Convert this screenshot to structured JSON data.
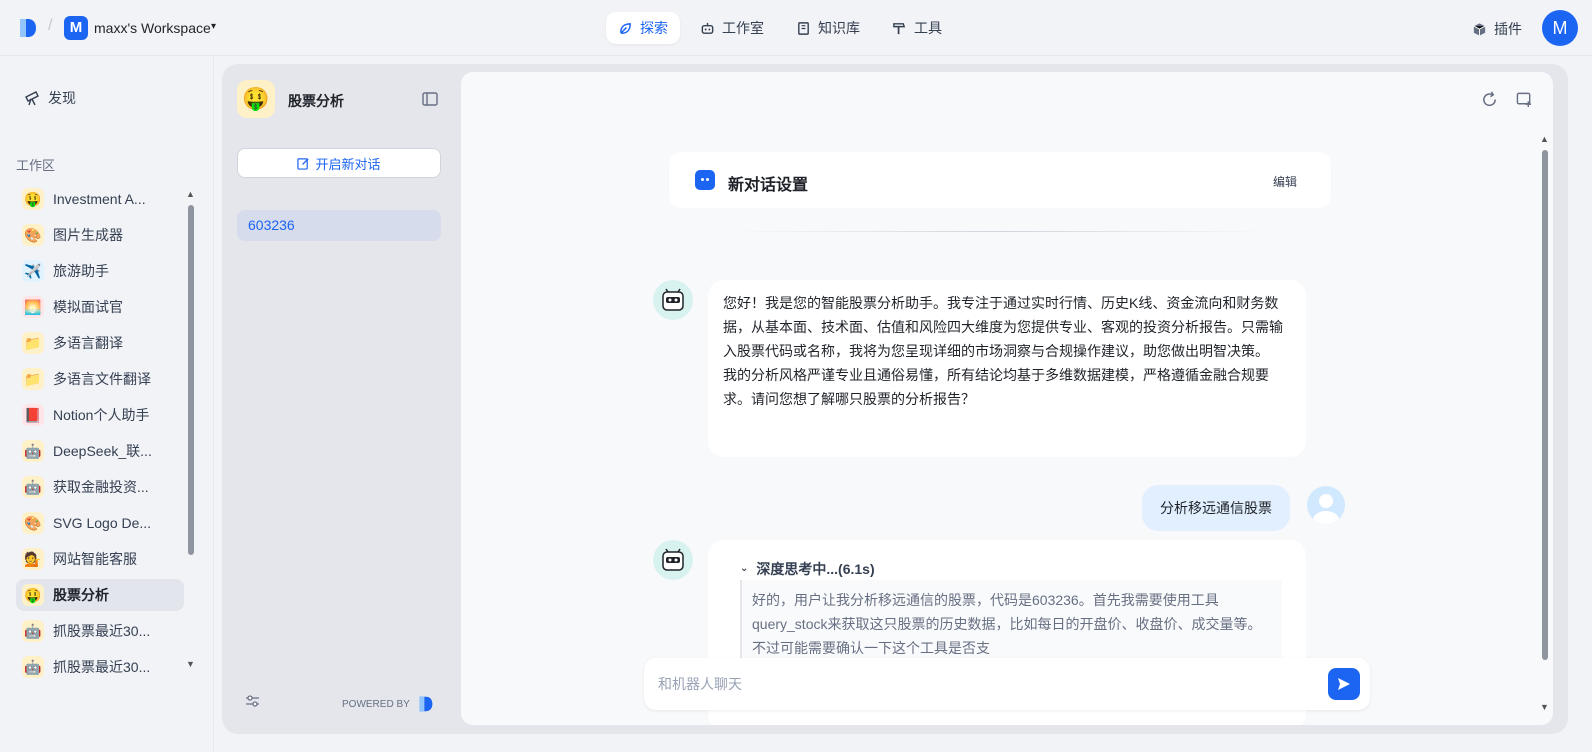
{
  "topbar": {
    "workspace_initial": "M",
    "workspace_name": "maxx's Workspace",
    "nav": [
      {
        "label": "探索",
        "icon": "compass-icon"
      },
      {
        "label": "工作室",
        "icon": "robot-icon"
      },
      {
        "label": "知识库",
        "icon": "book-icon"
      },
      {
        "label": "工具",
        "icon": "hammer-icon"
      }
    ],
    "plugin_label": "插件",
    "user_initial": "M",
    "accent": "#1c64f2"
  },
  "sidebar": {
    "discover_label": "发现",
    "section_label": "工作区",
    "apps": [
      {
        "label": "Investment A...",
        "emoji": "🤑",
        "bg": "#fef0c7"
      },
      {
        "label": "图片生成器",
        "emoji": "🎨",
        "bg": "#fef0c7"
      },
      {
        "label": "旅游助手",
        "emoji": "✈️",
        "bg": "#e0f2fe"
      },
      {
        "label": "模拟面试官",
        "emoji": "🌅",
        "bg": "#ffe4e8"
      },
      {
        "label": "多语言翻译",
        "emoji": "📁",
        "bg": "#fef0c7"
      },
      {
        "label": "多语言文件翻译",
        "emoji": "📁",
        "bg": "#fef0c7"
      },
      {
        "label": "Notion个人助手",
        "emoji": "📕",
        "bg": "#ffe4e8"
      },
      {
        "label": "DeepSeek_联...",
        "emoji": "🤖",
        "bg": "#fef0c7"
      },
      {
        "label": "获取金融投资...",
        "emoji": "🤖",
        "bg": "#fef0c7"
      },
      {
        "label": "SVG Logo De...",
        "emoji": "🎨",
        "bg": "#fef0c7"
      },
      {
        "label": "网站智能客服",
        "emoji": "💁",
        "bg": "#fef0c7"
      },
      {
        "label": "股票分析",
        "emoji": "🤑",
        "bg": "#fef0c7"
      },
      {
        "label": "抓股票最近30...",
        "emoji": "🤖",
        "bg": "#fef0c7"
      },
      {
        "label": "抓股票最近30...",
        "emoji": "🤖",
        "bg": "#fef0c7"
      }
    ]
  },
  "conversation_panel": {
    "app_emoji": "🤑",
    "app_title": "股票分析",
    "new_chat_label": "开启新对话",
    "conversations": [
      "603236"
    ],
    "powered_by": "POWERED BY"
  },
  "chat": {
    "settings_title": "新对话设置",
    "settings_edit": "编辑",
    "bot_message_1": "您好！我是您的智能股票分析助手。我专注于通过实时行情、历史K线、资金流向和财务数据，从基本面、技术面、估值和风险四大维度为您提供专业、客观的投资分析报告。只需输入股票代码或名称，我将为您呈现详细的市场洞察与合规操作建议，助您做出明智决策。",
    "bot_message_2": "我的分析风格严谨专业且通俗易懂，所有结论均基于多维数据建模，严格遵循金融合规要求。请问您想了解哪只股票的分析报告？",
    "user_message": "分析移远通信股票",
    "thinking_label": "深度思考中...(6.1s)",
    "thinking_text": "好的，用户让我分析移远通信的股票，代码是603236。首先我需要使用工具query_stock来获取这只股票的历史数据，比如每日的开盘价、收盘价、成交量等。不过可能需要确认一下这个工具是否支",
    "input_placeholder": "和机器人聊天"
  }
}
